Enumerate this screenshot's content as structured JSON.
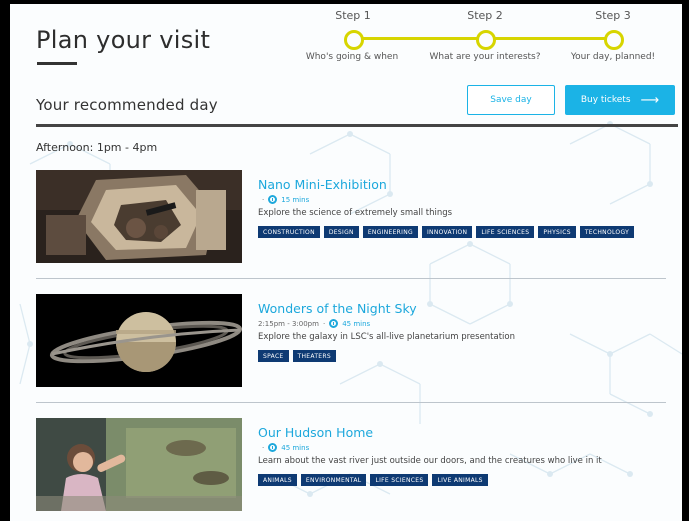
{
  "header": {
    "title": "Plan your visit"
  },
  "stepper": {
    "steps": [
      {
        "label": "Step 1",
        "desc": "Who's going & when"
      },
      {
        "label": "Step 2",
        "desc": "What are your interests?"
      },
      {
        "label": "Step 3",
        "desc": "Your day, planned!"
      }
    ]
  },
  "recommended": {
    "title": "Your recommended day",
    "save_label": "Save day",
    "buy_label": "Buy tickets"
  },
  "section": {
    "label": "Afternoon: 1pm - 4pm"
  },
  "items": [
    {
      "title": "Nano Mini-Exhibition",
      "time": "",
      "duration": "15 mins",
      "desc": "Explore the science of extremely small things",
      "tags": [
        "CONSTRUCTION",
        "DESIGN",
        "ENGINEERING",
        "INNOVATION",
        "LIFE SCIENCES",
        "PHYSICS",
        "TECHNOLOGY"
      ]
    },
    {
      "title": "Wonders of the Night Sky",
      "time": "2:15pm - 3:00pm",
      "duration": "45 mins",
      "desc": "Explore the galaxy in LSC's all-live planetarium presentation",
      "tags": [
        "SPACE",
        "THEATERS"
      ]
    },
    {
      "title": "Our Hudson Home",
      "time": "",
      "duration": "45 mins",
      "desc": "Learn about the vast river just outside our doors, and the creatures who live in it",
      "tags": [
        "ANIMALS",
        "ENVIRONMENTAL",
        "LIFE SCIENCES",
        "LIVE ANIMALS"
      ]
    }
  ],
  "colors": {
    "accent": "#1bb3e6",
    "stepper": "#d7d500",
    "tag_bg": "#0e3a73"
  }
}
